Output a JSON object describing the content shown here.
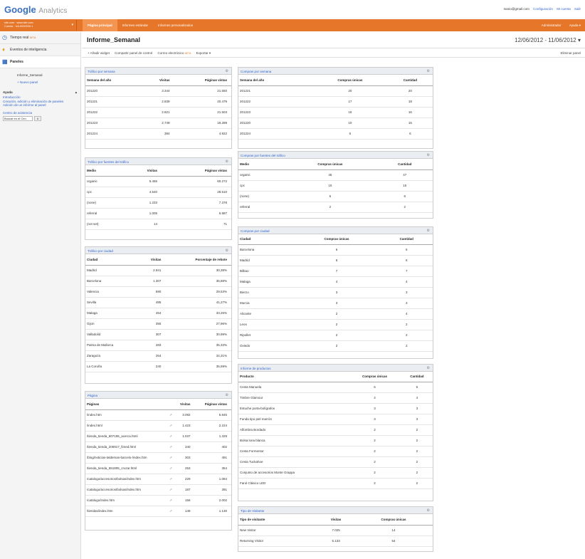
{
  "app": {
    "logo_google": "Google",
    "logo_analytics": "Analytics"
  },
  "toplinks": {
    "email": "mario@gmail.com",
    "config": "Configuración",
    "account": "Mi cuenta",
    "exit": "Salir"
  },
  "nav": {
    "account_line1": "site.com · www.site.com",
    "account_line2": "Cuenta · UA-0000000-1",
    "tabs": [
      "Página principal",
      "Informes estándar",
      "Informes personalizados"
    ],
    "right": [
      "Administrador",
      "Ayuda ▾"
    ]
  },
  "sidebar": {
    "items": [
      "Tiempo real",
      "Eventos de inteligencia",
      "Paneles"
    ],
    "beta": "BETA",
    "sub_items": [
      "Informe_Semanal",
      "+ Nuevo panel"
    ],
    "help_title": "Ayuda",
    "help_links": [
      "Introducción",
      "Creación, edición y eliminación de paneles",
      "Adición de un informe al panel"
    ],
    "help_center": "Centro de asistencia",
    "search_placeholder": "Buscar en el Cen",
    "search_btn": "Ir"
  },
  "report": {
    "title": "Informe_Semanal",
    "date_range": "12/06/2012 - 11/06/2012 ▾",
    "toolbar": [
      "+ Añadir widget",
      "Compartir panel de control",
      "Correo electrónico",
      "Exportar ▾"
    ],
    "toolbar_beta": "BETA",
    "toolbar_right": "Eliminar panel"
  },
  "widgets": {
    "traffic_week": {
      "title": "Tráfico por semana",
      "headers": [
        "Semana del año",
        "Visitas",
        "Páginas vistas"
      ],
      "rows": [
        [
          "201220",
          "3.344",
          "21.550"
        ],
        [
          "201221",
          "2.839",
          "20.479"
        ],
        [
          "201222",
          "2.821",
          "21.503"
        ],
        [
          "201223",
          "2.749",
          "19.289"
        ],
        [
          "201224",
          "384",
          "4.922"
        ]
      ]
    },
    "traffic_source": {
      "title": "Tráfico por fuentes del tráfico",
      "headers": [
        "Medio",
        "Visitas",
        "Páginas vistas"
      ],
      "rows": [
        [
          "organic",
          "5.456",
          "60.272"
        ],
        [
          "cpc",
          "4.540",
          "28.510"
        ],
        [
          "(none)",
          "1.233",
          "7.378"
        ],
        [
          "referral",
          "1.005",
          "6.987"
        ],
        [
          "(not set)",
          "14",
          "71"
        ]
      ]
    },
    "traffic_city": {
      "title": "Tráfico por ciudad",
      "headers": [
        "Ciudad",
        "Visitas",
        "Porcentaje de rebote"
      ],
      "rows": [
        [
          "Madrid",
          "2.941",
          "30,38%"
        ],
        [
          "Barcelona",
          "1.307",
          "35,88%"
        ],
        [
          "Valencia",
          "590",
          "29,53%"
        ],
        [
          "Sevilla",
          "485",
          "41,27%"
        ],
        [
          "Malaga",
          "454",
          "33,26%"
        ],
        [
          "Gijon",
          "355",
          "27,96%"
        ],
        [
          "Valladolid",
          "307",
          "30,99%"
        ],
        [
          "Palma de Mallorca",
          "283",
          "35,33%"
        ],
        [
          "Zaragoza",
          "264",
          "34,31%"
        ],
        [
          "La Coruña",
          "240",
          "35,59%"
        ]
      ]
    },
    "pages": {
      "title": "Página",
      "headers": [
        "Páginas",
        "Visitas",
        "Páginas vistas"
      ],
      "rows": [
        [
          "/index.htm",
          "3.092",
          "5.845"
        ],
        [
          "/index.html",
          "1.423",
          "2.224"
        ],
        [
          "/tienda_tienda_607195_acerca.html",
          "1.037",
          "1.329"
        ],
        [
          "/tienda_tienda_205917_fimed.html",
          "340",
          "402"
        ],
        [
          "/blog/noticias-taldemas-barcelo-/index.htm",
          "303",
          "491"
        ],
        [
          "/tienda_tienda_551805_cruzar.html",
          "253",
          "354"
        ],
        [
          "/catalogo/accesorios/bolsas/index.htm",
          "229",
          "1.084"
        ],
        [
          "/catalogo/accesorios/bolsas/index.htm",
          "187",
          "391"
        ],
        [
          "/catalogo/index.htm",
          "156",
          "2.002"
        ],
        [
          "/tiendas/index.htm",
          "149",
          "1.130"
        ]
      ]
    },
    "purchases_week": {
      "title": "Compras por semana",
      "headers": [
        "Semana del año",
        "Compras únicas",
        "Cantidad"
      ],
      "rows": [
        [
          "201221",
          "20",
          "20"
        ],
        [
          "201222",
          "17",
          "18"
        ],
        [
          "201223",
          "16",
          "16"
        ],
        [
          "201220",
          "10",
          "15"
        ],
        [
          "201224",
          "6",
          "6"
        ]
      ]
    },
    "purchases_source": {
      "title": "Compras por fuentes del tráfico",
      "headers": [
        "Medio",
        "Compras únicas",
        "Cantidad"
      ],
      "rows": [
        [
          "organic",
          "45",
          "47"
        ],
        [
          "cpc",
          "15",
          "15"
        ],
        [
          "(none)",
          "6",
          "6"
        ],
        [
          "referral",
          "2",
          "2"
        ]
      ]
    },
    "purchases_city": {
      "title": "Compras por ciudad",
      "headers": [
        "Ciudad",
        "Compras únicas",
        "Cantidad"
      ],
      "rows": [
        [
          "Barcelona",
          "6",
          "6"
        ],
        [
          "Madrid",
          "6",
          "6"
        ],
        [
          "Bilbao",
          "7",
          "7"
        ],
        [
          "Malaga",
          "4",
          "4"
        ],
        [
          "Bierzo",
          "3",
          "3"
        ],
        [
          "Murcia",
          "3",
          "3"
        ],
        [
          "Alicante",
          "2",
          "4"
        ],
        [
          "Leon",
          "2",
          "2"
        ],
        [
          "Ripollet",
          "2",
          "2"
        ],
        [
          "Oviedo",
          "2",
          "2"
        ]
      ]
    },
    "products": {
      "title": "Informe de productos",
      "headers": [
        "Producto",
        "Compras únicas",
        "Cantidad"
      ],
      "rows": [
        [
          "Cesta Manuela",
          "6",
          "6"
        ],
        [
          "Timbre Glamour",
          "4",
          "4"
        ],
        [
          "Estuche porta-bolígrafos",
          "3",
          "3"
        ],
        [
          "Funda tipo piel marrón",
          "3",
          "3"
        ],
        [
          "Alfombra Bordado",
          "2",
          "2"
        ],
        [
          "Bolsa lona blanca",
          "2",
          "2"
        ],
        [
          "Cesta Formentor",
          "2",
          "2"
        ],
        [
          "Cesta Tuckahoe",
          "2",
          "2"
        ],
        [
          "Conjunto de accesorios Monte Grappa",
          "2",
          "2"
        ],
        [
          "Farol Clásico LED",
          "2",
          "2"
        ]
      ]
    },
    "visitor_type": {
      "title": "Tipo de Visitante",
      "headers": [
        "Tipo de visitante",
        "Visitas",
        "Compras únicas"
      ],
      "rows": [
        [
          "New Visitor",
          "7.025",
          "14"
        ],
        [
          "Returning Visitor",
          "5.133",
          "54"
        ]
      ]
    }
  }
}
